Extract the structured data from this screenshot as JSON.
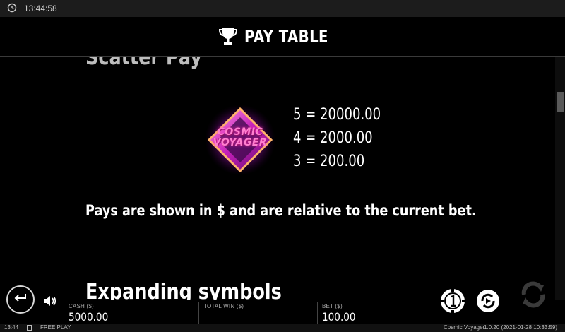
{
  "status_bar": {
    "time": "13:44:58",
    "clock_icon": "clock-icon"
  },
  "header": {
    "title": "PAY TABLE",
    "icon": "trophy-icon"
  },
  "sections": {
    "scatter_heading": "Scatter Pay",
    "expanding_heading": "Expanding symbols"
  },
  "scatter_symbol": {
    "line1": "COSMIC",
    "line2": "VOYAGER",
    "pays": [
      "5 = 20000.00",
      "4 = 2000.00",
      "3 = 200.00"
    ]
  },
  "note": "Pays are shown in $ and are relative to the current bet.",
  "controls": {
    "cash_label": "CASH ($)",
    "cash_value": "5000.00",
    "total_win_label": "TOTAL WIN ($)",
    "total_win_value": "",
    "bet_label": "BET ($)",
    "bet_value": "100.00"
  },
  "footer": {
    "time": "13:44",
    "mode": "FREE PLAY",
    "game_name": "Cosmic Voyager",
    "version": "1.0.20 (2021-01-28 10:33:59)"
  },
  "colors": {
    "background": "#000000",
    "accent_pink": "#ff2fb0",
    "text": "#ffffff"
  }
}
